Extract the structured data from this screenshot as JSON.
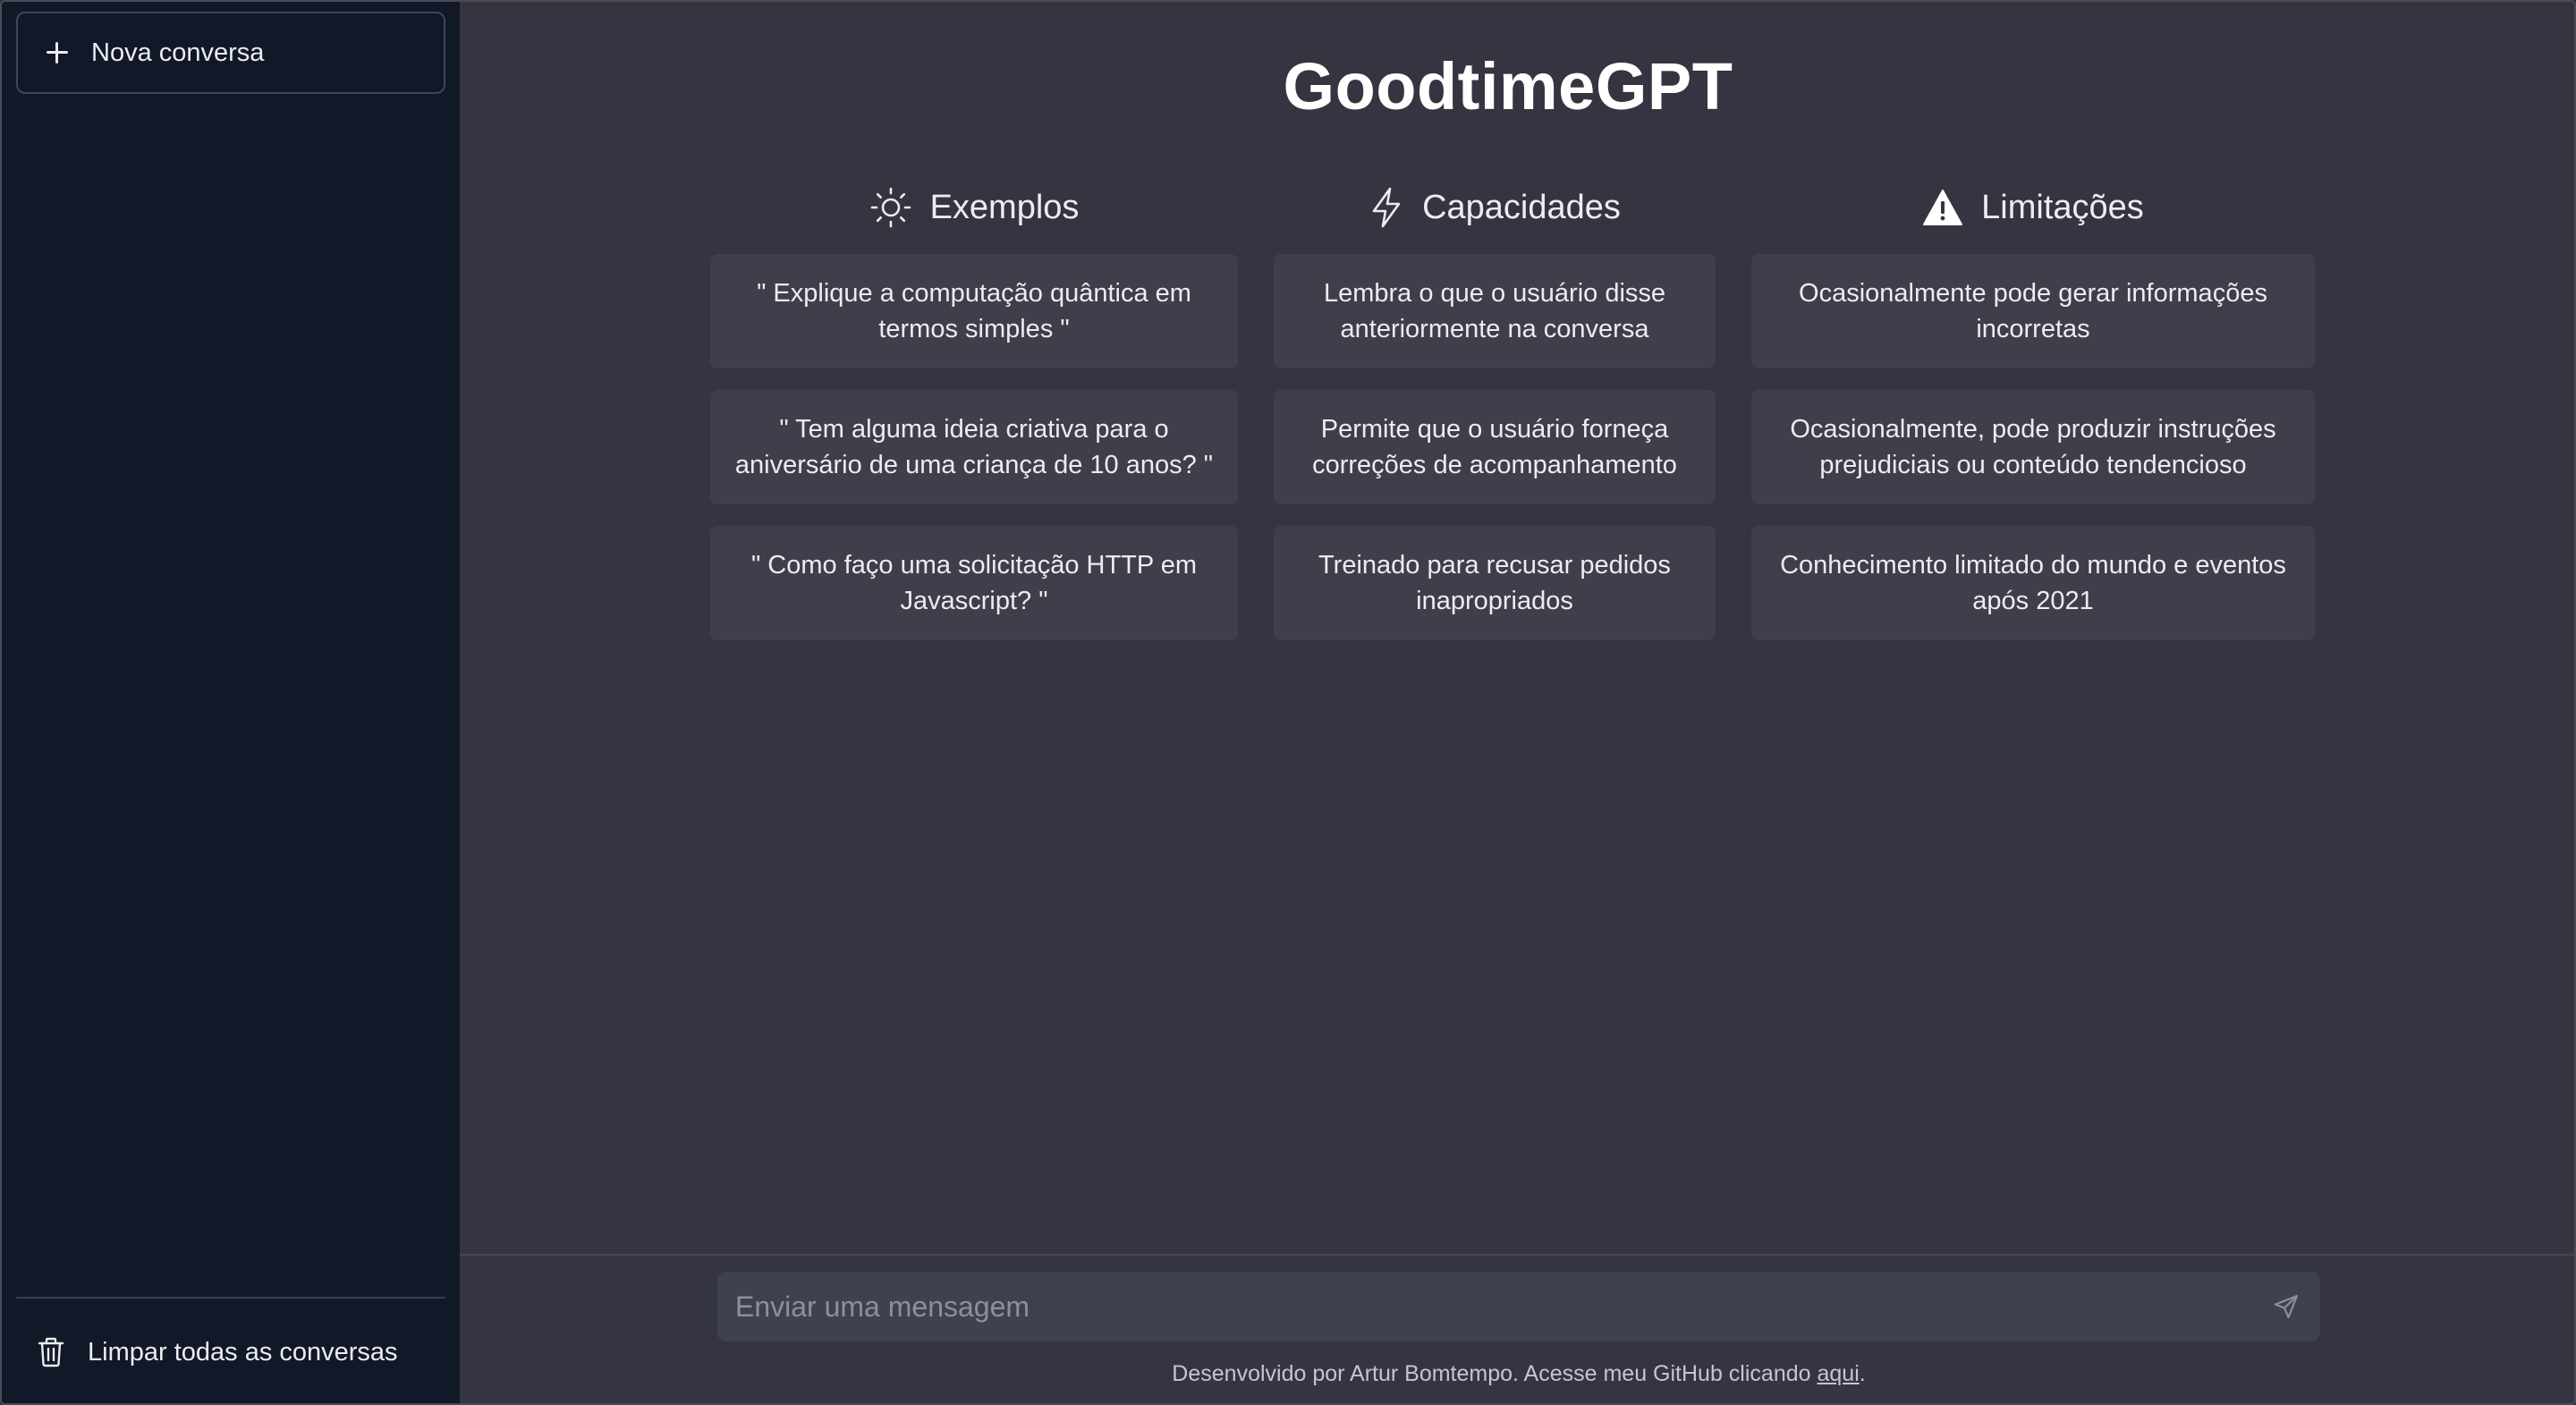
{
  "sidebar": {
    "new_chat_label": "Nova conversa",
    "clear_all_label": "Limpar todas as conversas"
  },
  "main": {
    "title": "GoodtimeGPT",
    "columns": [
      {
        "heading": "Exemplos",
        "icon": "sun-icon",
        "cards": [
          "\" Explique a computação quântica em termos simples \"",
          "\" Tem alguma ideia criativa para o aniversário de uma criança de 10 anos? \"",
          "\" Como faço uma solicitação HTTP em Javascript? \""
        ]
      },
      {
        "heading": "Capacidades",
        "icon": "lightning-icon",
        "cards": [
          "Lembra o que o usuário disse anteriormente na conversa",
          "Permite que o usuário forneça correções de acompanhamento",
          "Treinado para recusar pedidos inapropriados"
        ]
      },
      {
        "heading": "Limitações",
        "icon": "warning-icon",
        "cards": [
          "Ocasionalmente pode gerar informações incorretas",
          "Ocasionalmente, pode produzir instruções prejudiciais ou conteúdo tendencioso",
          "Conhecimento limitado do mundo e eventos após 2021"
        ]
      }
    ]
  },
  "composer": {
    "placeholder": "Enviar uma mensagem",
    "value": ""
  },
  "footer": {
    "text_before": "Desenvolvido por Artur Bomtempo. Acesse meu GitHub clicando ",
    "link_label": "aqui",
    "text_after": "."
  },
  "colors": {
    "sidebar_bg": "#111827",
    "main_bg": "#343541",
    "card_bg": "#3e3f4b",
    "input_bg": "#40414f"
  }
}
